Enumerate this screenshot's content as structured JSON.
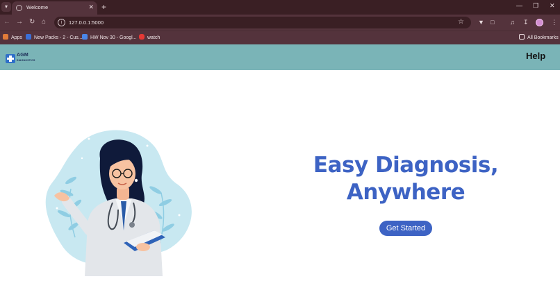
{
  "browser": {
    "tab_title": "Welcome",
    "new_tab": "+",
    "url": "127.0.0.1:5000",
    "bookmarks": [
      {
        "label": "Apps",
        "icon": "apps-grid-icon",
        "color": "#e07b39"
      },
      {
        "label": "New Packs - 2 - Cus...",
        "icon": "play-icon",
        "color": "#3b6fd6"
      },
      {
        "label": "HW Nov 30 - Googl...",
        "icon": "google-docs-icon",
        "color": "#4a86e8"
      },
      {
        "label": "watch",
        "icon": "youtube-icon",
        "color": "#e53935"
      }
    ],
    "all_bookmarks": "All Bookmarks"
  },
  "header": {
    "logo_name": "AGM",
    "logo_sub": "DIAGNOSTICS",
    "help": "Help",
    "background": "#7ab4b7"
  },
  "hero": {
    "title_line1": "Easy Diagnosis,",
    "title_line2": "Anywhere",
    "cta_label": "Get Started",
    "accent": "#3d63c4"
  }
}
